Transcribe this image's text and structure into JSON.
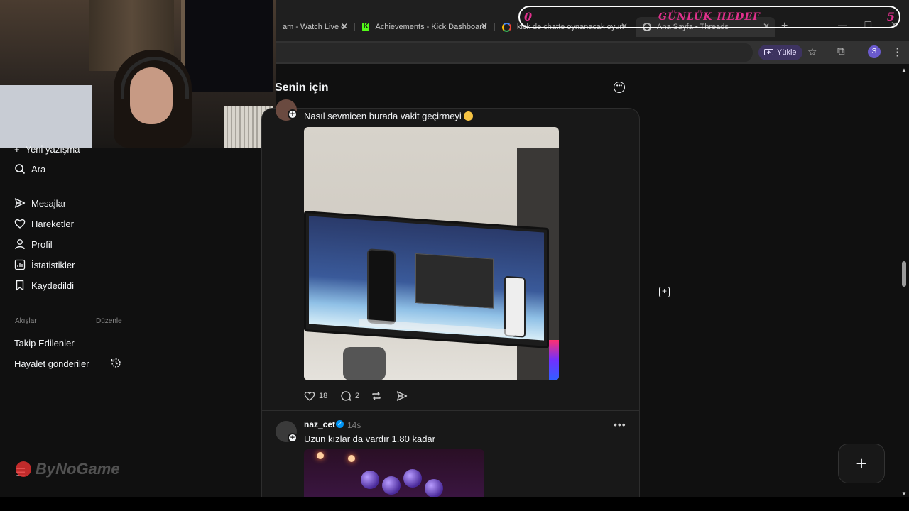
{
  "browser": {
    "tabs": [
      {
        "label": "am - Watch Live o"
      },
      {
        "label": "Achievements - Kick Dashboard"
      },
      {
        "label": "kick de chatte oynanacak oyun"
      },
      {
        "label": "Ana Sayfa • Threads"
      }
    ],
    "new_tab_glyph": "+",
    "upload_label": "Yükle",
    "profile_initial": "S"
  },
  "overlay": {
    "goal_start": "0",
    "goal_title": "GÜNLÜK HEDEF",
    "goal_end": "5",
    "watermark": "ByNoGame"
  },
  "sidebar": {
    "new_post": "Yeni yazışma",
    "search": "Ara",
    "messages": "Mesajlar",
    "activity": "Hareketler",
    "profile": "Profil",
    "insights": "İstatistikler",
    "saved": "Kaydedildi",
    "feeds_label": "Akışlar",
    "edit_label": "Düzenle",
    "following": "Takip Edilenler",
    "ghost_posts": "Hayalet gönderiler"
  },
  "feed": {
    "title": "Senin için",
    "posts": [
      {
        "text": "Nasıl sevmicen burada vakit geçirmeyi",
        "likes": "18",
        "replies": "2"
      },
      {
        "username": "naz_cet",
        "time": "14s",
        "text": "Uzun kızlar da vardır 1.80 kadar"
      }
    ]
  },
  "colors": {
    "background": "#101010",
    "panel": "#181818",
    "goal_text": "#e0308c",
    "verified": "#0095f6"
  }
}
